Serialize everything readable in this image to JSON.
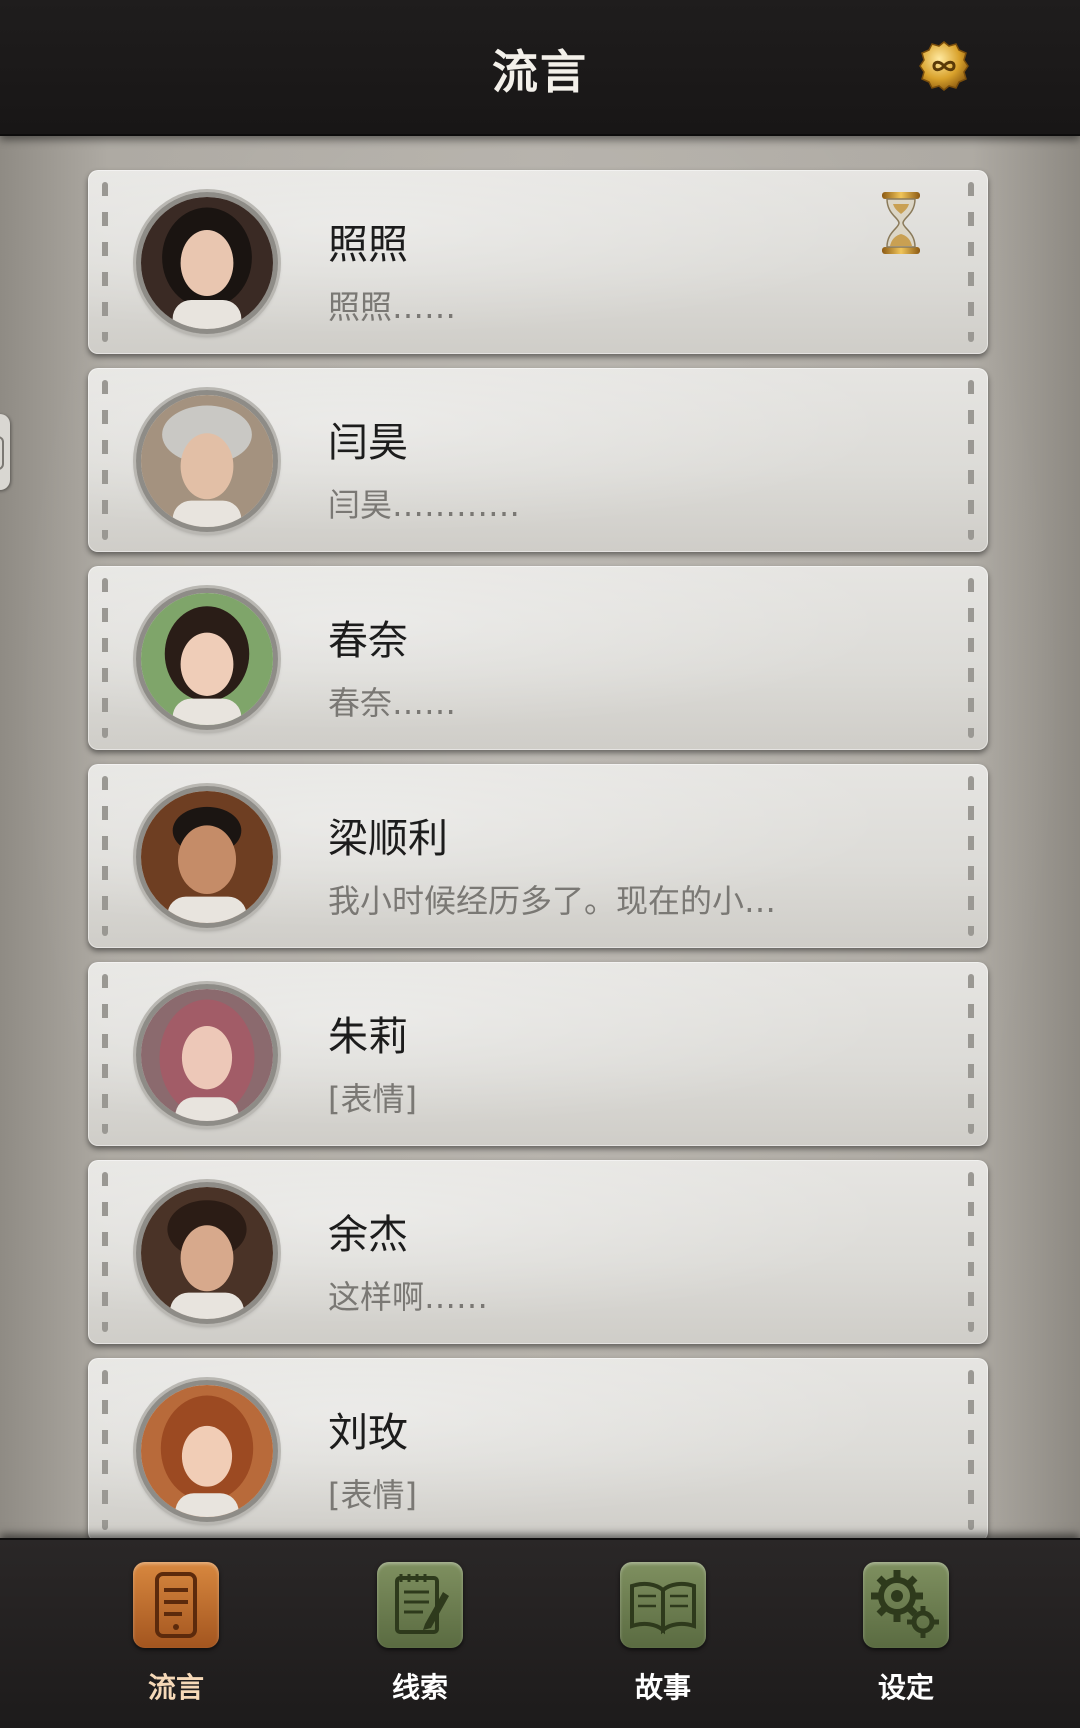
{
  "header": {
    "title": "流言",
    "coin_icon": "infinity-coin-icon"
  },
  "conversations": [
    {
      "name": "照照",
      "preview": "照照……",
      "avatar_colors": [
        "#3a2a24",
        "#e9c6b0",
        "#1a1411"
      ],
      "waiting": true
    },
    {
      "name": "闫昊",
      "preview": "闫昊…………",
      "avatar_colors": [
        "#a4927f",
        "#e2bfa6",
        "#c9c8c4"
      ],
      "waiting": false
    },
    {
      "name": "春奈",
      "preview": "春奈……",
      "avatar_colors": [
        "#7fa56a",
        "#efcdb8",
        "#2a1d17"
      ],
      "waiting": false
    },
    {
      "name": "梁顺利",
      "preview": "我小时候经历多了。现在的小…",
      "avatar_colors": [
        "#6e3e22",
        "#c58c68",
        "#1b1512"
      ],
      "waiting": false
    },
    {
      "name": "朱莉",
      "preview": "[表情]",
      "avatar_colors": [
        "#8b6a6e",
        "#edc8b8",
        "#a25c67"
      ],
      "waiting": false
    },
    {
      "name": "余杰",
      "preview": "这样啊……",
      "avatar_colors": [
        "#4a3327",
        "#d7a98c",
        "#2b1c15"
      ],
      "waiting": false
    },
    {
      "name": "刘玫",
      "preview": "[表情]",
      "avatar_colors": [
        "#b86a3a",
        "#f1cdb6",
        "#9c4a22"
      ],
      "waiting": false
    }
  ],
  "nav": {
    "items": [
      {
        "label": "流言",
        "icon": "phone-chat-icon",
        "active": true
      },
      {
        "label": "线索",
        "icon": "notepad-icon",
        "active": false
      },
      {
        "label": "故事",
        "icon": "open-book-icon",
        "active": false
      },
      {
        "label": "设定",
        "icon": "gears-icon",
        "active": false
      }
    ]
  },
  "colors": {
    "header_bg": "#1f1d1d",
    "card_bg": "#e2e1de",
    "nav_active": "#c9773a",
    "nav_inactive": "#6e7f52"
  }
}
